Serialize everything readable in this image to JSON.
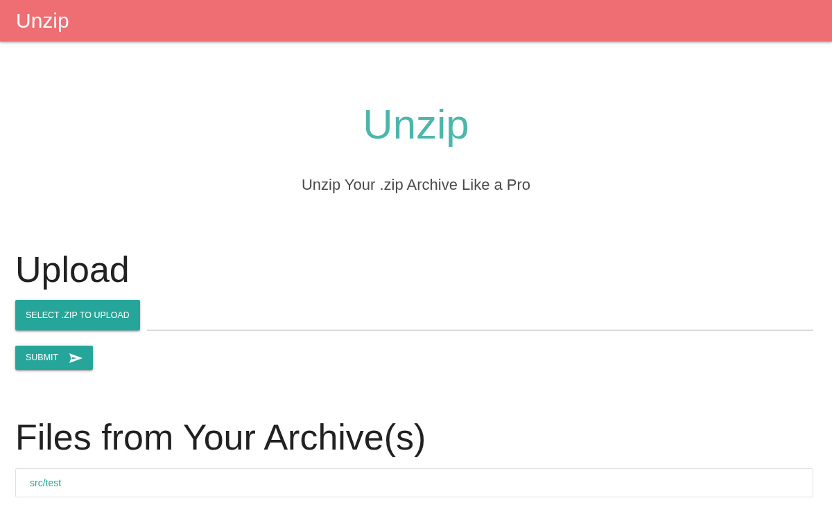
{
  "navbar": {
    "title": "Unzip"
  },
  "hero": {
    "title": "Unzip",
    "subtitle": "Unzip Your .zip Archive Like a Pro"
  },
  "upload": {
    "heading": "Upload",
    "select_button": "SELECT .ZIP TO UPLOAD",
    "submit_button": "SUBMIT"
  },
  "files": {
    "heading": "Files from Your Archive(s)",
    "items": [
      {
        "label": "src/test"
      }
    ]
  }
}
